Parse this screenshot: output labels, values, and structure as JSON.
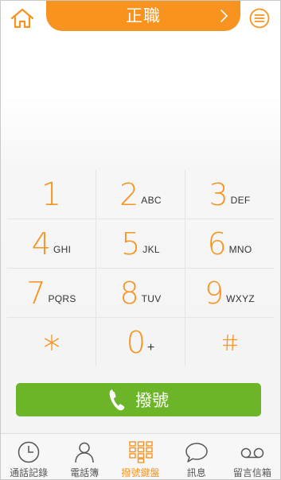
{
  "header": {
    "title": "正職",
    "home_icon": "home-icon",
    "menu_icon": "menu-icon",
    "next_icon": "chevron-right-icon"
  },
  "colors": {
    "accent": "#f7931e",
    "call_green": "#6cb428",
    "text_dark": "#333333"
  },
  "keypad": {
    "rows": [
      [
        {
          "digit": "1",
          "letters": ""
        },
        {
          "digit": "2",
          "letters": "ABC"
        },
        {
          "digit": "3",
          "letters": "DEF"
        }
      ],
      [
        {
          "digit": "4",
          "letters": "GHI"
        },
        {
          "digit": "5",
          "letters": "JKL"
        },
        {
          "digit": "6",
          "letters": "MNO"
        }
      ],
      [
        {
          "digit": "7",
          "letters": "PQRS"
        },
        {
          "digit": "8",
          "letters": "TUV"
        },
        {
          "digit": "9",
          "letters": "WXYZ"
        }
      ],
      [
        {
          "digit": "*",
          "letters": ""
        },
        {
          "digit": "0",
          "letters": "+"
        },
        {
          "digit": "#",
          "letters": ""
        }
      ]
    ]
  },
  "call": {
    "label": "撥號",
    "icon": "phone-icon"
  },
  "nav": {
    "items": [
      {
        "label": "通話記錄",
        "icon": "clock-icon",
        "active": false
      },
      {
        "label": "電話簿",
        "icon": "person-icon",
        "active": false
      },
      {
        "label": "撥號鍵盤",
        "icon": "keypad-icon",
        "active": true
      },
      {
        "label": "訊息",
        "icon": "chat-bubble-icon",
        "active": false
      },
      {
        "label": "留言信箱",
        "icon": "voicemail-icon",
        "active": false
      }
    ]
  }
}
